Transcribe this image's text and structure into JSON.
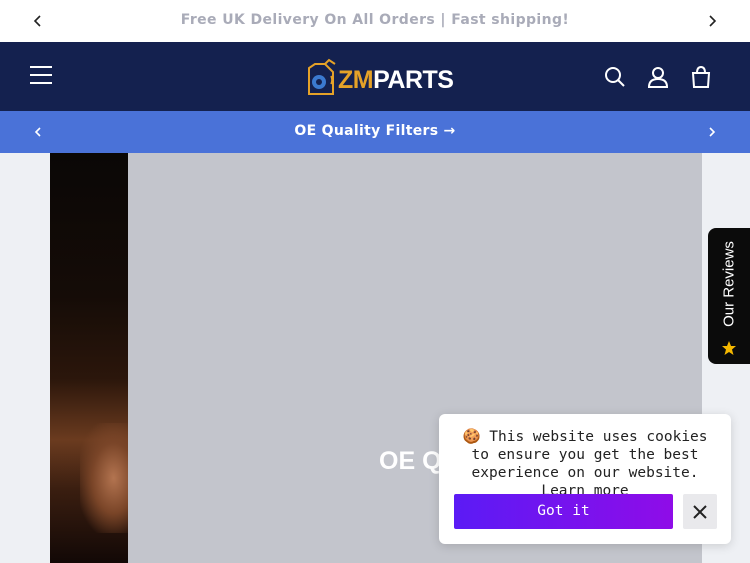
{
  "announcement": {
    "text": "Free UK Delivery On All Orders | Fast shipping!",
    "prev_icon": "chevron-left-icon",
    "next_icon": "chevron-right-icon"
  },
  "header": {
    "menu_icon": "hamburger-menu-icon",
    "logo": {
      "brand_accent": "ZM",
      "brand_main": "PARTS"
    },
    "icons": [
      "search-icon",
      "account-icon",
      "cart-icon"
    ]
  },
  "promo_bar": {
    "text": "OE Quality Filters",
    "arrow": "→"
  },
  "hero": {
    "heading": "OE Q"
  },
  "reviews_tab": {
    "label": "Our Reviews"
  },
  "cookie_banner": {
    "emoji": "🍪",
    "message": "This website uses cookies to ensure you get the best experience on our website.",
    "learn_more": "Learn more",
    "accept_label": "Got it",
    "close_icon": "close-icon"
  },
  "colors": {
    "header_bg": "#14214f",
    "promo_bg": "#4a72d8",
    "brand_orange": "#e5a228",
    "accept_gradient_start": "#5b1bf5",
    "accept_gradient_end": "#8f0ce8"
  }
}
